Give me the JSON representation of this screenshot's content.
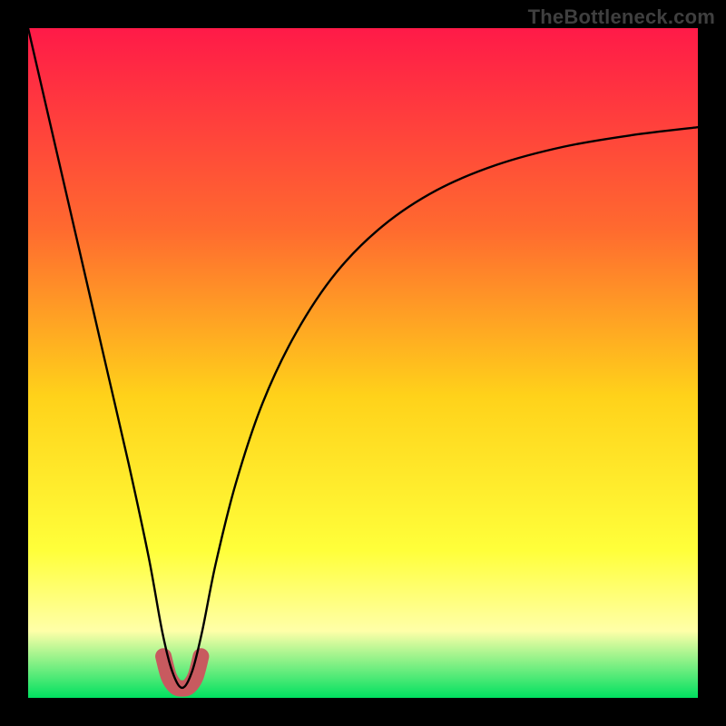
{
  "watermark": "TheBottleneck.com",
  "colors": {
    "frame": "#000000",
    "gradient_top": "#ff1a48",
    "gradient_mid_upper": "#ff6a2f",
    "gradient_mid": "#ffd21a",
    "gradient_mid_lower": "#ffff3a",
    "gradient_pale": "#ffffa8",
    "gradient_bottom": "#00e060",
    "curve": "#000000",
    "highlight": "#c85a5f"
  },
  "chart_data": {
    "type": "line",
    "title": "",
    "xlabel": "",
    "ylabel": "",
    "xlim": [
      0,
      100
    ],
    "ylim": [
      0,
      100
    ],
    "grid": false,
    "series": [
      {
        "name": "bottleneck-curve",
        "x": [
          0,
          3,
          6,
          9,
          12,
          15,
          18,
          20,
          21.5,
          23,
          24.5,
          26,
          28,
          31,
          35,
          40,
          46,
          53,
          61,
          70,
          80,
          90,
          100
        ],
        "values": [
          100,
          87,
          74,
          61,
          48,
          35,
          21,
          10,
          4,
          1.5,
          4,
          10,
          20,
          32,
          44,
          54.5,
          63.5,
          70.5,
          75.8,
          79.6,
          82.3,
          84,
          85.2
        ]
      }
    ],
    "highlight_region": {
      "name": "minimum-band",
      "x": [
        20.2,
        21,
        22,
        23,
        24,
        25,
        25.8
      ],
      "values": [
        6.2,
        3.2,
        1.7,
        1.4,
        1.7,
        3.2,
        6.2
      ]
    }
  }
}
